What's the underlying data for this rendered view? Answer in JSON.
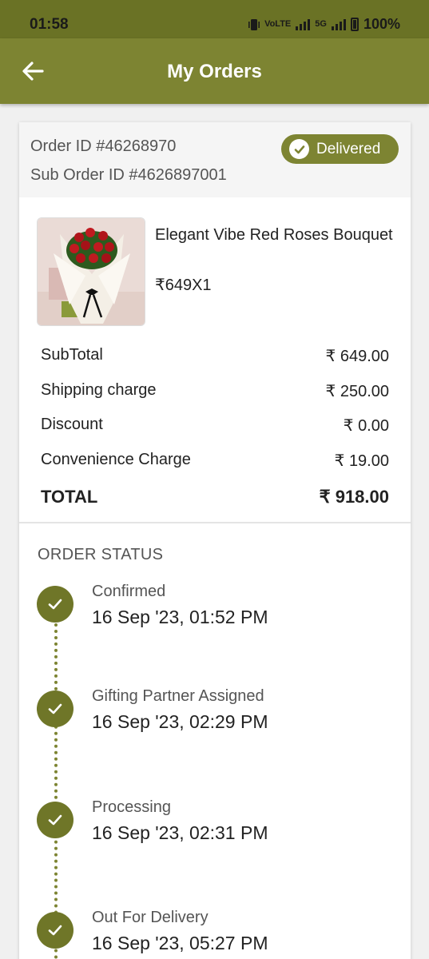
{
  "status_bar": {
    "time": "01:58",
    "vol_lte": "VoLTE",
    "net_5g": "5G",
    "battery": "100%"
  },
  "app_bar": {
    "title": "My Orders",
    "back_icon": "arrow-left-icon"
  },
  "order": {
    "order_id": "Order ID #46268970",
    "sub_order_id": "Sub Order ID #4626897001",
    "status_badge": "Delivered"
  },
  "product": {
    "name": "Elegant Vibe Red Roses Bouquet",
    "price_qty": "₹649X1"
  },
  "summary": [
    {
      "label": "SubTotal",
      "value": "₹ 649.00"
    },
    {
      "label": "Shipping charge",
      "value": "₹ 250.00"
    },
    {
      "label": "Discount",
      "value": "₹ 0.00"
    },
    {
      "label": "Convenience Charge",
      "value": "₹ 19.00"
    }
  ],
  "total": {
    "label": "TOTAL",
    "value": "₹ 918.00"
  },
  "order_status": {
    "title": "ORDER STATUS",
    "steps": [
      {
        "name": "Confirmed",
        "time": "16 Sep '23, 01:52 PM"
      },
      {
        "name": "Gifting Partner Assigned",
        "time": "16 Sep '23, 02:29 PM"
      },
      {
        "name": "Processing",
        "time": "16 Sep '23, 02:31 PM"
      },
      {
        "name": "Out For Delivery",
        "time": "16 Sep '23, 05:27 PM"
      }
    ]
  },
  "colors": {
    "app_bar": "#7d8432",
    "status_bar": "#6a7225",
    "accent": "#6f7628"
  }
}
